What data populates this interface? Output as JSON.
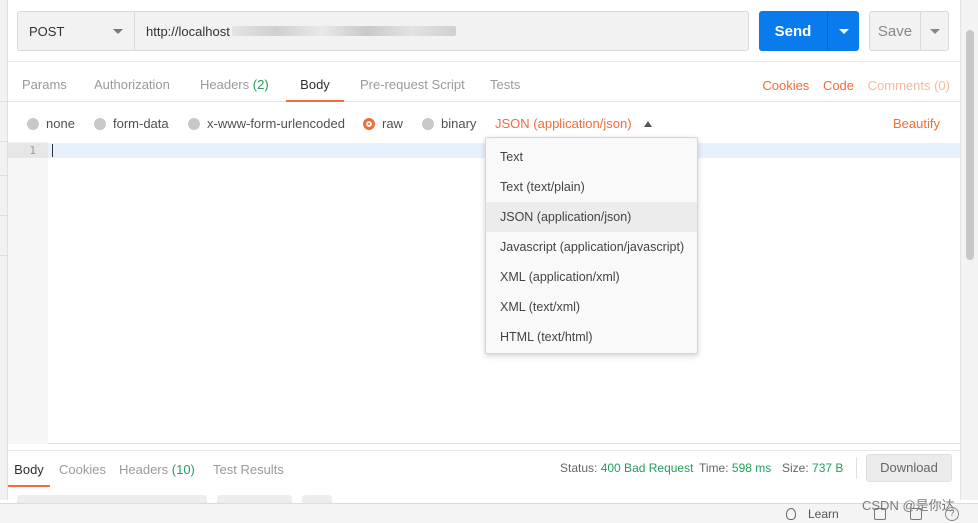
{
  "request": {
    "method": "POST",
    "url_prefix": "http://localhost",
    "send_label": "Send",
    "save_label": "Save"
  },
  "tabs": {
    "params": "Params",
    "authorization": "Authorization",
    "headers": "Headers",
    "headers_count": "(2)",
    "body": "Body",
    "prerequest": "Pre-request Script",
    "tests": "Tests",
    "cookies": "Cookies",
    "code": "Code",
    "comments": "Comments (0)"
  },
  "body_options": {
    "none": "none",
    "form_data": "form-data",
    "urlencoded": "x-www-form-urlencoded",
    "raw": "raw",
    "binary": "binary",
    "selected": "raw",
    "content_type": "JSON (application/json)",
    "beautify": "Beautify"
  },
  "editor": {
    "line_number": "1"
  },
  "dropdown": {
    "items": [
      "Text",
      "Text (text/plain)",
      "JSON (application/json)",
      "Javascript (application/javascript)",
      "XML (application/xml)",
      "XML (text/xml)",
      "HTML (text/html)"
    ],
    "selected_index": 2
  },
  "response": {
    "tab_body": "Body",
    "tab_cookies": "Cookies",
    "tab_headers": "Headers",
    "tab_headers_count": "(10)",
    "tab_tests": "Test Results",
    "status_label": "Status:",
    "status_value": "400 Bad Request",
    "time_label": "Time:",
    "time_value": "598 ms",
    "size_label": "Size:",
    "size_value": "737 B",
    "download_label": "Download"
  },
  "statusbar": {
    "learn": "Learn",
    "help": "?"
  },
  "watermark": "CSDN @是你达",
  "colors": {
    "accent_orange": "#f26b3a",
    "send_blue": "#097bed",
    "success_green": "#20a05b"
  }
}
